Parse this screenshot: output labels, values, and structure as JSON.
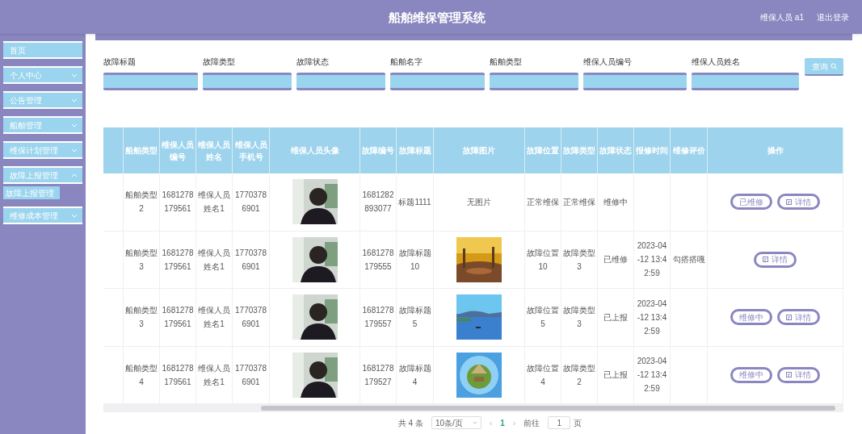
{
  "header": {
    "title": "船舶维保管理系统",
    "user": "维保人员 a1",
    "logout": "退出登录"
  },
  "sidebar": {
    "items": [
      {
        "label": "首页",
        "has_children": false
      },
      {
        "label": "个人中心",
        "expanded": false,
        "has_children": true
      },
      {
        "label": "公告管理",
        "expanded": false,
        "has_children": true
      },
      {
        "label": "船舶管理",
        "expanded": false,
        "has_children": true
      },
      {
        "label": "维保计划管理",
        "expanded": false,
        "has_children": true
      },
      {
        "label": "故障上报管理",
        "expanded": true,
        "has_children": true,
        "children": [
          {
            "label": "故障上报管理"
          }
        ]
      },
      {
        "label": "维修成本管理",
        "expanded": false,
        "has_children": true
      }
    ]
  },
  "search": {
    "fields": [
      {
        "label": "故障标题"
      },
      {
        "label": "故障类型"
      },
      {
        "label": "故障状态"
      },
      {
        "label": "船舶名字"
      },
      {
        "label": "船舶类型"
      },
      {
        "label": "维保人员编号"
      },
      {
        "label": "维保人员姓名"
      }
    ],
    "button": "查询"
  },
  "table": {
    "columns": [
      "",
      "船舶类型",
      "维保人员编号",
      "维保人员姓名",
      "维保人员手机号",
      "维保人员头像",
      "故障编号",
      "故障标题",
      "故障图片",
      "故障位置",
      "故障类型",
      "故障状态",
      "报修时间",
      "维修评价",
      "操作"
    ],
    "rows": [
      {
        "ship_type": "船舶类型2",
        "staff_no": "1681278179561",
        "staff_name": "维保人员姓名1",
        "phone": "17703786901",
        "fault_no": "1681282893077",
        "fault_title": "标题1111",
        "fault_image": {
          "kind": "text",
          "text": "无图片"
        },
        "location": "正常维保",
        "fault_type": "正常维保",
        "status": "维修中",
        "time": "",
        "evaluation": "",
        "actions": [
          {
            "kind": "status",
            "label": "已维修"
          },
          {
            "kind": "detail",
            "label": "详情"
          }
        ]
      },
      {
        "ship_type": "船舶类型3",
        "staff_no": "1681278179561",
        "staff_name": "维保人员姓名1",
        "phone": "17703786901",
        "fault_no": "1681278179555",
        "fault_title": "故障标题10",
        "fault_image": {
          "kind": "picture"
        },
        "location": "故障位置10",
        "fault_type": "故障类型3",
        "status": "已维修",
        "time": "2023-04-12 13:42:59",
        "evaluation": "勾搭搭嘎",
        "actions": [
          {
            "kind": "detail",
            "label": "详情"
          }
        ]
      },
      {
        "ship_type": "船舶类型3",
        "staff_no": "1681278179561",
        "staff_name": "维保人员姓名1",
        "phone": "17703786901",
        "fault_no": "1681278179557",
        "fault_title": "故障标题5",
        "fault_image": {
          "kind": "picture"
        },
        "location": "故障位置5",
        "fault_type": "故障类型3",
        "status": "已上报",
        "time": "2023-04-12 13:42:59",
        "evaluation": "",
        "actions": [
          {
            "kind": "status",
            "label": "维修中"
          },
          {
            "kind": "detail",
            "label": "详情"
          }
        ]
      },
      {
        "ship_type": "船舶类型4",
        "staff_no": "1681278179561",
        "staff_name": "维保人员姓名1",
        "phone": "17703786901",
        "fault_no": "1681278179527",
        "fault_title": "故障标题4",
        "fault_image": {
          "kind": "picture"
        },
        "location": "故障位置4",
        "fault_type": "故障类型2",
        "status": "已上报",
        "time": "2023-04-12 13:42:59",
        "evaluation": "",
        "actions": [
          {
            "kind": "status",
            "label": "维修中"
          },
          {
            "kind": "detail",
            "label": "详情"
          }
        ]
      }
    ]
  },
  "pagination": {
    "total": "共 4 条",
    "page_size": "10条/页",
    "prev": "‹",
    "current": "1",
    "next": "›",
    "goto": "前往",
    "goto_value": "1",
    "page_unit": "页"
  }
}
